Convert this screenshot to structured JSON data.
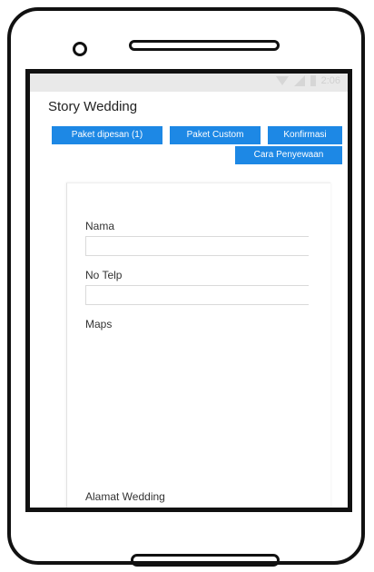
{
  "status_bar": {
    "time": "2:06"
  },
  "app": {
    "title": "Story Wedding"
  },
  "buttons": {
    "paket_dipesan": "Paket dipesan (1)",
    "paket_custom": "Paket Custom",
    "konfirmasi": "Konfirmasi",
    "cara_penyewaan": "Cara Penyewaan"
  },
  "form": {
    "nama_label": "Nama",
    "nama_value": "",
    "telp_label": "No Telp",
    "telp_value": "",
    "maps_label": "Maps",
    "alamat_label": "Alamat Wedding"
  },
  "colors": {
    "accent": "#1d88e5",
    "frame": "#111111"
  }
}
